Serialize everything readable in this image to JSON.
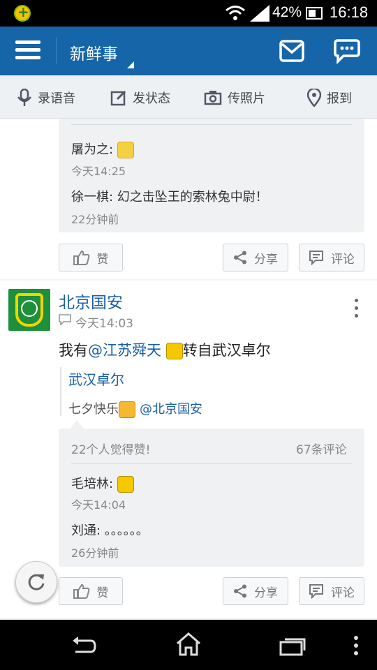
{
  "status_bar": {
    "battery_percent": "42%",
    "time": "16:18"
  },
  "header": {
    "title": "新鲜事"
  },
  "toolbar": {
    "voice": "录语音",
    "status": "发状态",
    "photo": "传照片",
    "checkin": "报到"
  },
  "post1": {
    "comments": [
      {
        "name": "屠为之:",
        "time": "今天14:25"
      },
      {
        "text": "徐一棋: 幻之击坠王的索林兔中尉！",
        "time": "22分钟前"
      }
    ],
    "like_label": "赞",
    "share_label": "分享",
    "comment_label": "评论"
  },
  "post2": {
    "author": "北京国安",
    "time": "今天14:03",
    "text_prefix": "我有",
    "mention": "@江苏舜天",
    "text_suffix": "转自武汉卓尔",
    "quote_author": "武汉卓尔",
    "quote_text": "七夕快乐",
    "quote_mention": "@北京国安",
    "likes_text": "22个人觉得赞!",
    "comment_count": "67条评论",
    "comments": [
      {
        "name": "毛培林:",
        "time": "今天14:04"
      },
      {
        "text": "刘通: 。。。。。。",
        "time": "26分钟前"
      }
    ],
    "like_label": "赞",
    "share_label": "分享",
    "comment_label": "评论"
  },
  "icons": {
    "app": "app-notification-icon",
    "wifi": "wifi-icon",
    "signal": "signal-icon",
    "battery": "battery-icon",
    "menu": "menu-icon",
    "mail": "mail-icon",
    "chat": "chat-icon",
    "mic": "mic-icon",
    "edit": "edit-icon",
    "camera": "camera-icon",
    "location": "location-pin-icon",
    "thumbs_up": "thumbs-up-icon",
    "share": "share-icon",
    "comment": "comment-icon",
    "refresh": "refresh-icon",
    "back": "back-icon",
    "home": "home-icon",
    "recents": "recents-icon",
    "more": "more-vertical-icon"
  },
  "colors": {
    "header_bg": "#1565a8",
    "link": "#1a5fa5"
  }
}
